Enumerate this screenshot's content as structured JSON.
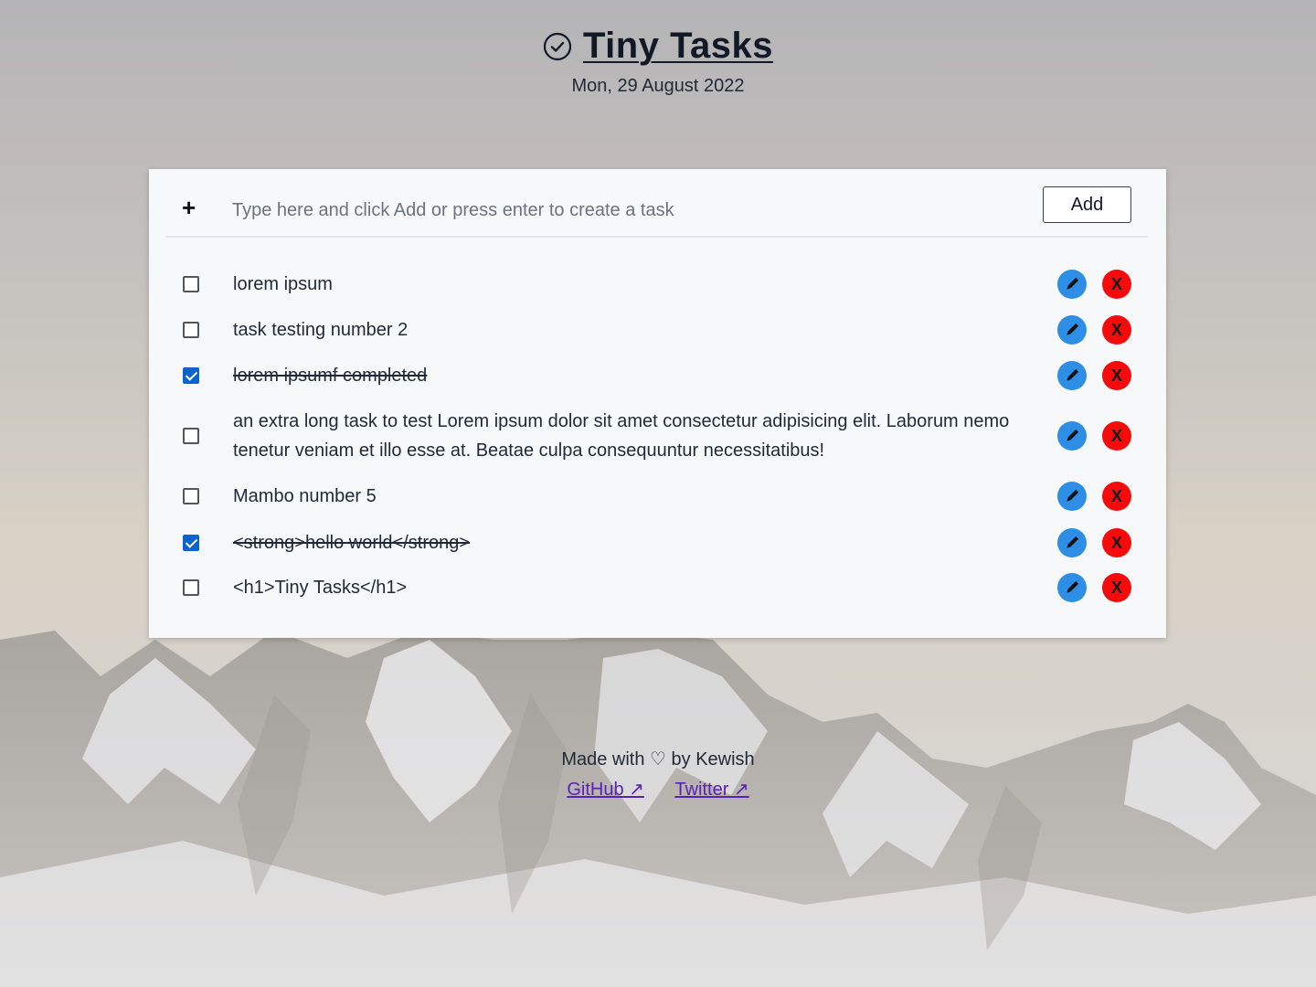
{
  "header": {
    "title": "Tiny Tasks",
    "date": "Mon, 29 August 2022"
  },
  "composer": {
    "plus": "+",
    "placeholder": "Type here and click Add or press enter to create a task",
    "add_label": "Add"
  },
  "tasks": [
    {
      "text": "lorem ipsum",
      "done": false
    },
    {
      "text": "task testing number 2",
      "done": false
    },
    {
      "text": "lorem ipsumf completed",
      "done": true
    },
    {
      "text": "an extra long task to test Lorem ipsum dolor sit amet consectetur adipisicing elit. Laborum nemo tenetur veniam et illo esse at. Beatae culpa consequuntur necessitatibus!",
      "done": false
    },
    {
      "text": "Mambo number 5",
      "done": false
    },
    {
      "text": "<strong>hello world</strong>",
      "done": true
    },
    {
      "text": "<h1>Tiny Tasks</h1>",
      "done": false
    }
  ],
  "actions": {
    "delete_label": "X",
    "edit_icon": "pencil-icon"
  },
  "footer": {
    "made_with": "Made with ♡ by Kewish",
    "github": "GitHub ↗",
    "twitter": "Twitter ↗"
  },
  "colors": {
    "edit": "#2e8ee5",
    "delete": "#f50b0b",
    "checkbox": "#0b63ce",
    "link": "#5b21b6"
  }
}
